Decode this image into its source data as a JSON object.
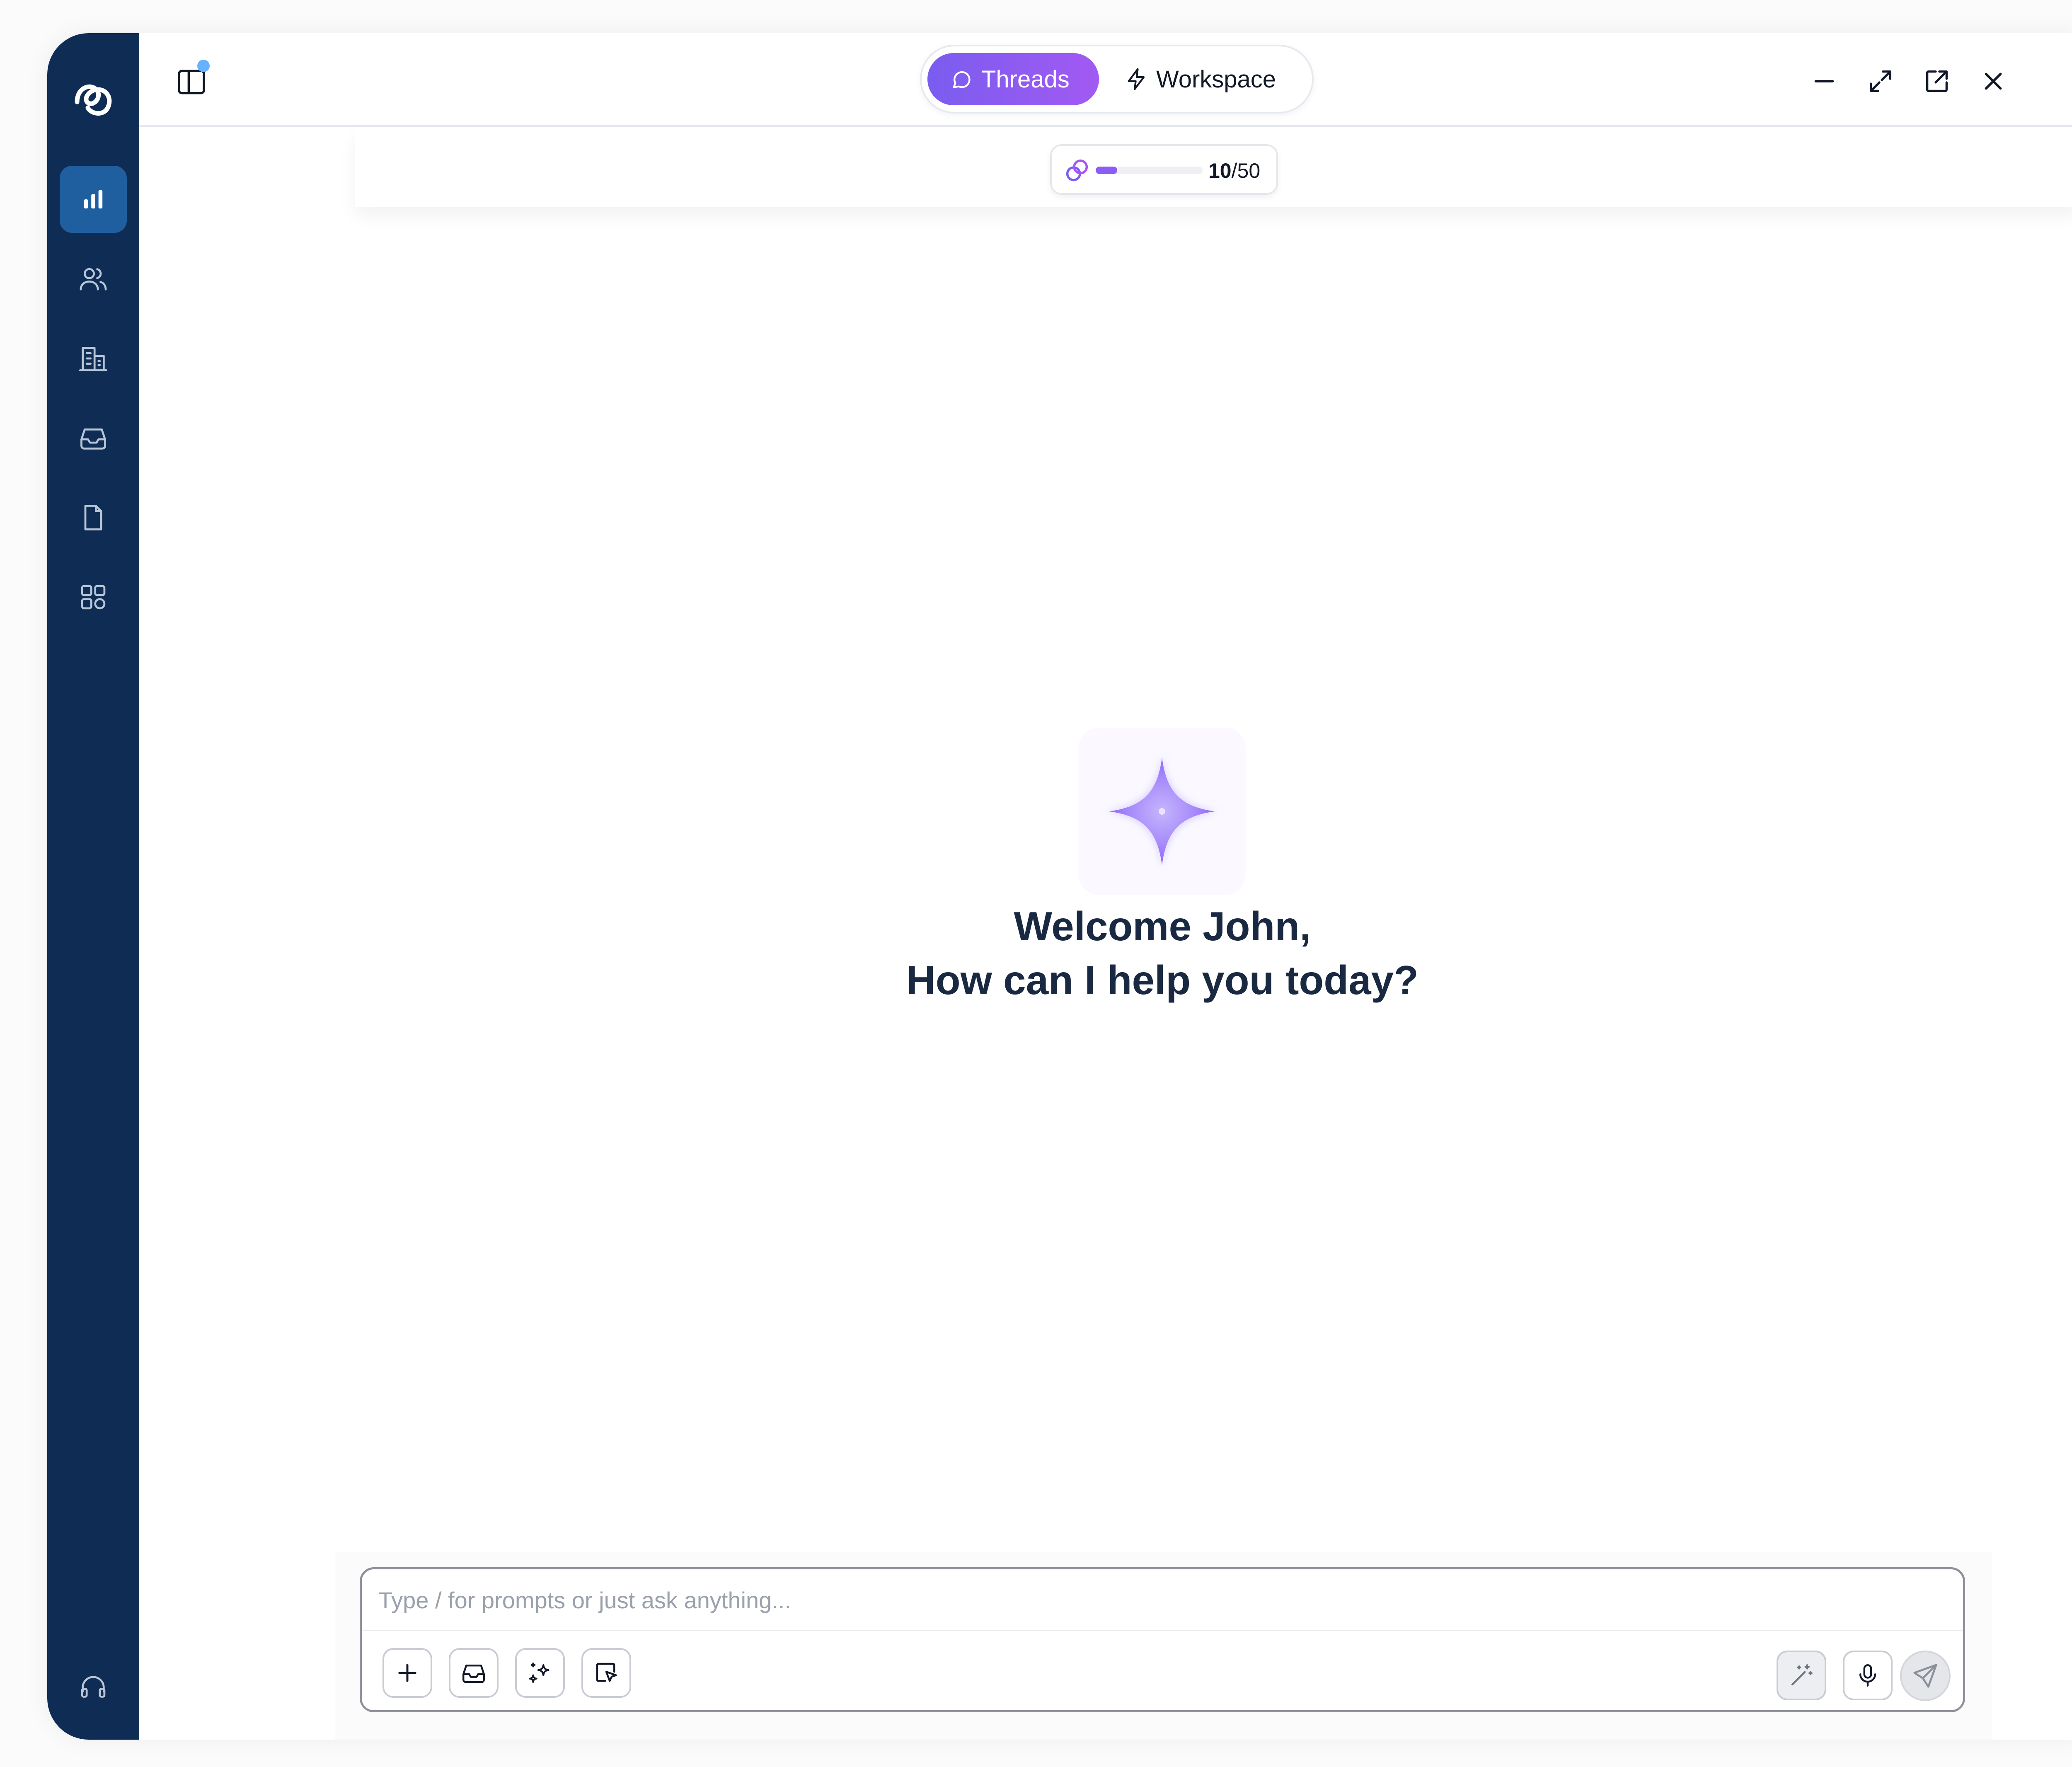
{
  "header": {
    "tabs": [
      {
        "label": "Threads",
        "icon": "chat-bubble-icon",
        "active": true
      },
      {
        "label": "Workspace",
        "icon": "lightning-icon",
        "active": false
      }
    ]
  },
  "credits": {
    "used": "10",
    "total": "/50",
    "fraction": 0.2
  },
  "welcome": {
    "line1": "Welcome John,",
    "line2": "How can I help you today?"
  },
  "composer": {
    "placeholder": "Type / for prompts or just ask anything..."
  },
  "sidebar": {
    "items": [
      {
        "icon": "bar-chart-icon",
        "active": true
      },
      {
        "icon": "users-icon",
        "active": false
      },
      {
        "icon": "building-icon",
        "active": false
      },
      {
        "icon": "inbox-icon",
        "active": false
      },
      {
        "icon": "file-icon",
        "active": false
      },
      {
        "icon": "apps-grid-icon",
        "active": false
      },
      {
        "icon": "headset-icon",
        "active": false
      }
    ]
  },
  "colors": {
    "sidebar": "#0f2d54",
    "sidebar_active": "#1f5fa0",
    "accent_start": "#7a5cf0",
    "accent_end": "#a25af2",
    "heading": "#1a2942"
  }
}
